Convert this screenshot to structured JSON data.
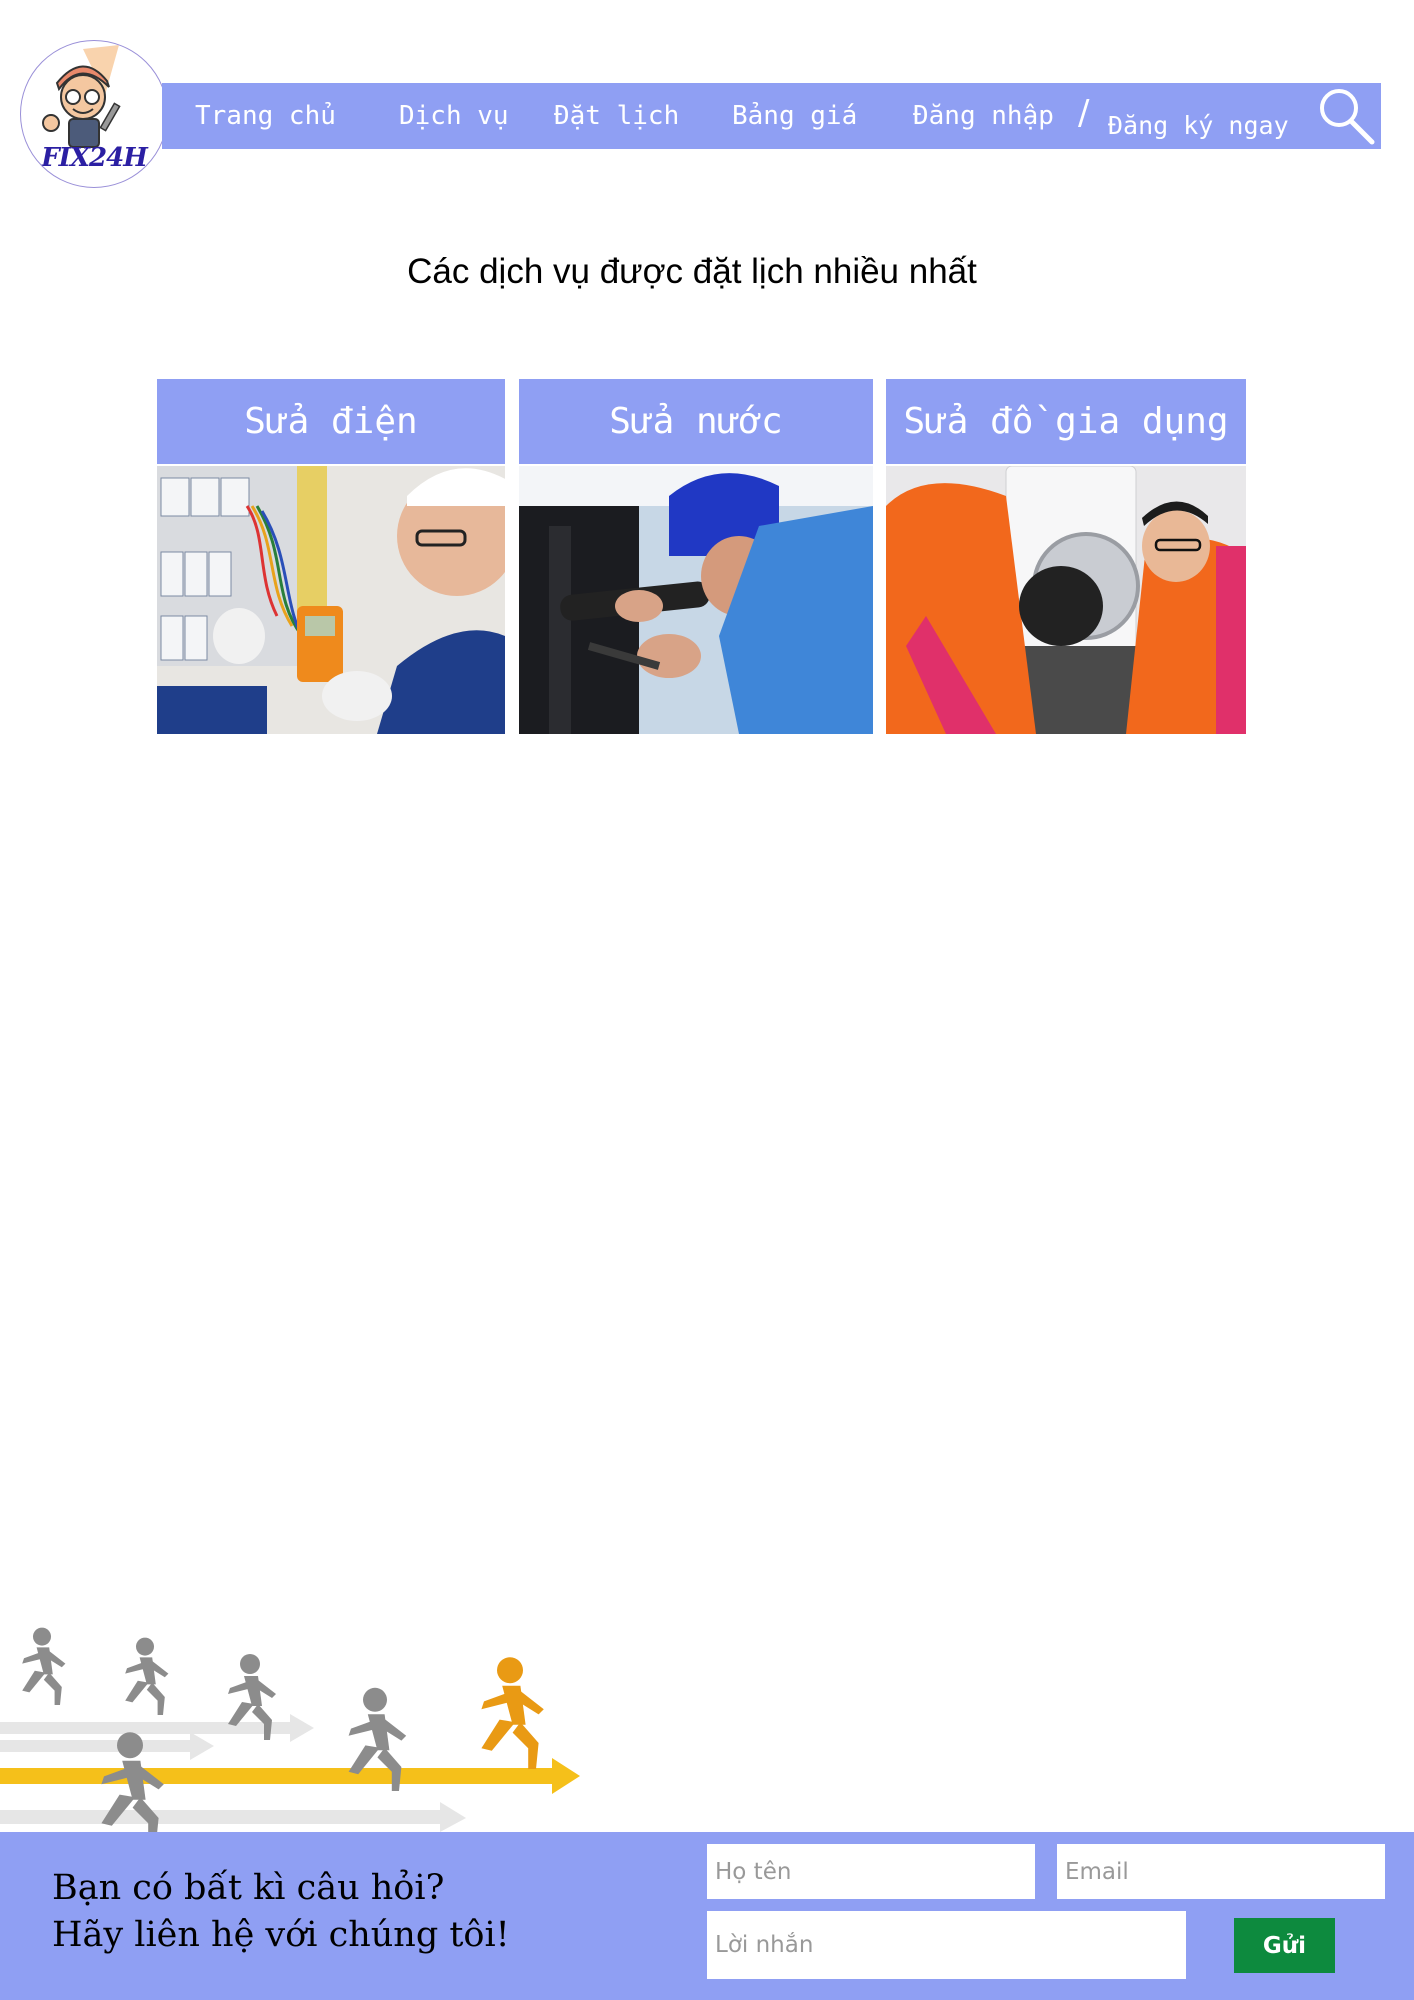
{
  "header": {
    "logo_text": "FIX24H",
    "nav": [
      {
        "label": "Trang chủ"
      },
      {
        "label": "Dịch vụ"
      },
      {
        "label": "Đặt lịch"
      },
      {
        "label": "Bảng giá"
      },
      {
        "label": "Đăng nhập"
      }
    ],
    "separator": "/",
    "register_label": "Đăng ký ngay"
  },
  "services": {
    "title": "Các dịch vụ được đặt lịch nhiều nhất",
    "cards": [
      {
        "title": "Sửa điện"
      },
      {
        "title": "Sửa nước"
      },
      {
        "title": "Sửa đồ gia dụng"
      }
    ]
  },
  "contact": {
    "line1": "Bạn có bất kì câu hỏi?",
    "line2": "Hãy liên hệ với chúng tôi!",
    "name_placeholder": "Họ tên",
    "email_placeholder": "Email",
    "message_placeholder": "Lời nhắn",
    "send_label": "Gửi"
  },
  "colors": {
    "accent": "#8f9ff3",
    "send_button": "#0d8a3e",
    "logo_text": "#2b1fa3"
  }
}
